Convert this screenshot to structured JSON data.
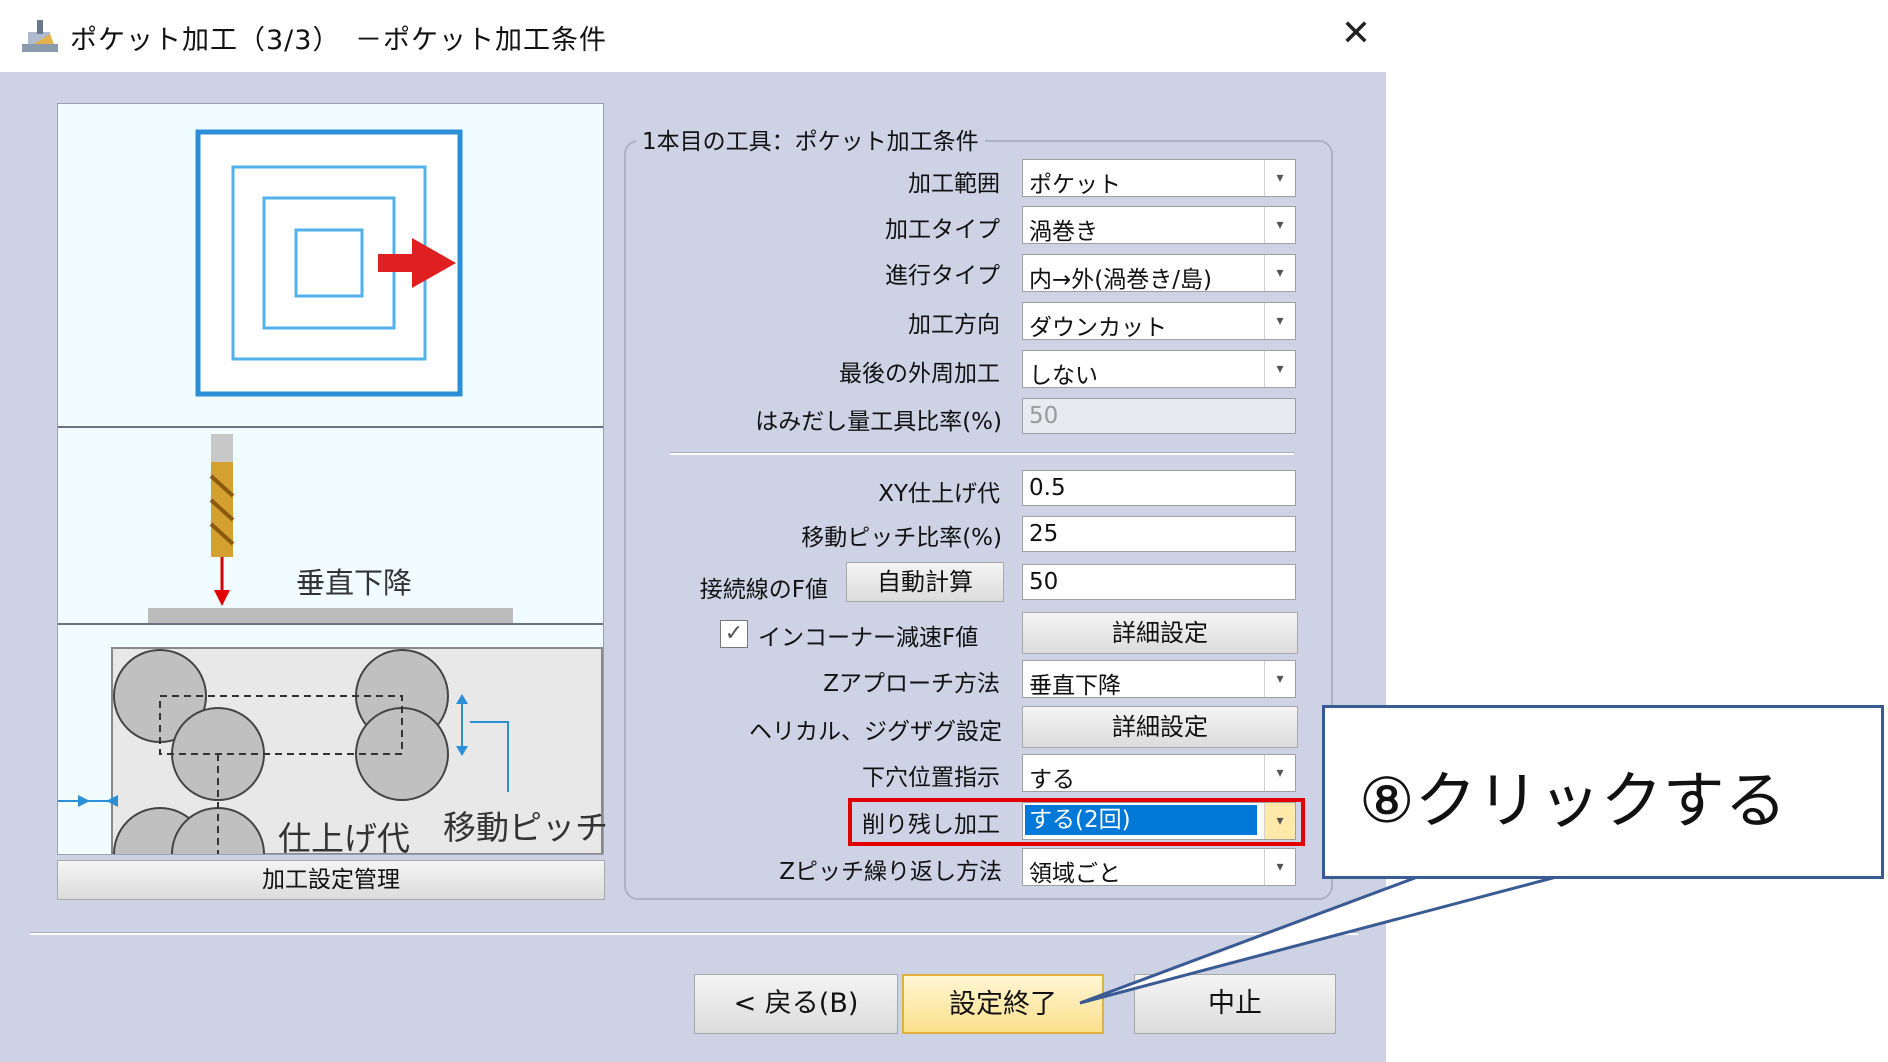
{
  "window": {
    "title": "ポケット加工（3/3）　－ポケット加工条件",
    "close_label": "✕",
    "app_icon": "cnc-machine-icon"
  },
  "illustration": {
    "label_vertical": "垂直下降",
    "label_finish": "仕上げ代",
    "label_pitch": "移動ピッチ",
    "manage_button": "加工設定管理"
  },
  "group": {
    "title": "1本目の工具：ポケット加工条件",
    "fields": [
      {
        "label": "加工範囲",
        "value": "ポケット"
      },
      {
        "label": "加工タイプ",
        "value": "渦巻き"
      },
      {
        "label": "進行タイプ",
        "value": "内→外(渦巻き/島)"
      },
      {
        "label": "加工方向",
        "value": "ダウンカット"
      },
      {
        "label": "最後の外周加工",
        "value": "しない"
      },
      {
        "label": "はみだし量工具比率(%)",
        "value": "50"
      },
      {
        "label": "XY仕上げ代",
        "value": "0.5"
      },
      {
        "label": "移動ピッチ比率(%)",
        "value": "25"
      },
      {
        "label": "接続線のF値",
        "value": "50"
      },
      {
        "label": "インコーナー減速F値",
        "checked": true
      },
      {
        "label": "Zアプローチ方法",
        "value": "垂直下降"
      },
      {
        "label": "ヘリカル、ジグザグ設定"
      },
      {
        "label": "下穴位置指示",
        "value": "する"
      },
      {
        "label": "削り残し加工",
        "value": "する(2回)"
      },
      {
        "label": "Zピッチ繰り返し方法",
        "value": "領域ごと"
      }
    ],
    "auto_calc_button": "自動計算",
    "detail_button": "詳細設定",
    "check_mark": "✓",
    "dropdown_arrow": "▾"
  },
  "footer": {
    "back_button": "< 戻る(B)",
    "finish_button": "設定終了",
    "cancel_button": "中止"
  },
  "annotation": {
    "callout_text": "⑧クリックする",
    "highlight_color": "#e00000",
    "callout_border_color": "#3a5a94"
  }
}
